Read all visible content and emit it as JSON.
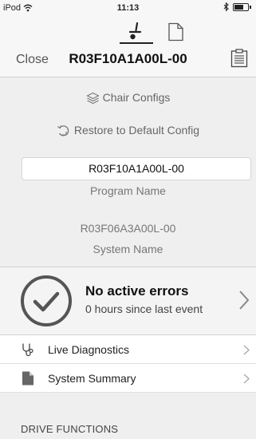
{
  "status_bar": {
    "device": "iPod",
    "time": "11:13"
  },
  "header": {
    "close_label": "Close",
    "title": "R03F10A1A00L-00"
  },
  "config": {
    "chair_configs_label": "Chair Configs",
    "restore_label": "Restore to Default Config",
    "program_name_value": "R03F10A1A00L-00",
    "program_name_caption": "Program Name",
    "system_name_value": "R03F06A3A00L-00",
    "system_name_caption": "System Name"
  },
  "errors": {
    "title": "No active errors",
    "subtitle": "0 hours since last event"
  },
  "list": {
    "live_diagnostics": "Live Diagnostics",
    "system_summary": "System Summary"
  },
  "sections": {
    "drive_functions": "DRIVE FUNCTIONS"
  },
  "icons": {
    "wifi": "wifi-icon",
    "bluetooth": "bluetooth-icon",
    "battery": "battery-icon",
    "chair_mode": "wheelchair-icon",
    "document_mode": "document-icon",
    "clipboard": "clipboard-icon",
    "layers": "layers-icon",
    "restore": "restore-icon",
    "check": "checkmark-circle-icon",
    "stethoscope": "stethoscope-icon",
    "summary": "document-fill-icon",
    "chevron": "chevron-right-icon"
  }
}
